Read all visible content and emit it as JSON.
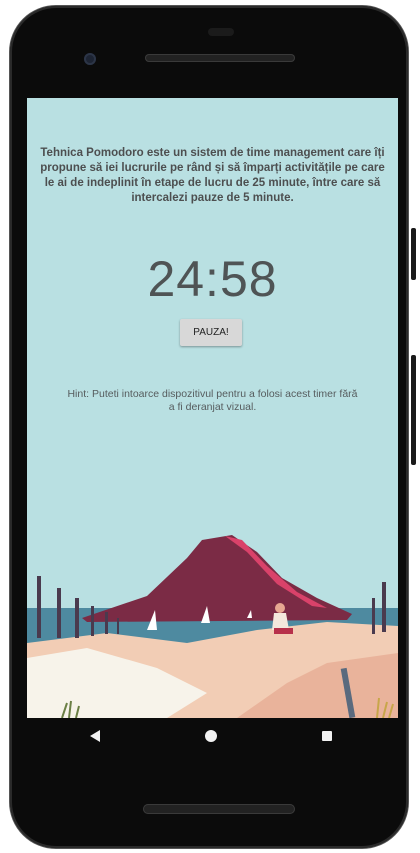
{
  "app": {
    "description": "Tehnica Pomodoro este un sistem de time management care îți propune să iei lucrurile pe rând și să împarți activitățile pe care le ai de indeplinit în etape de lucru de 25 minute, între care să intercalezi pauze de 5 minute.",
    "timer": "24:58",
    "pause_label": "PAUZA!",
    "hint": "Hint: Puteti intoarce dispozitivul pentru a folosi acest timer fără a fi deranjat vizual."
  },
  "navbar": {
    "back_icon": "back-triangle-icon",
    "home_icon": "home-circle-icon",
    "recents_icon": "recents-square-icon"
  },
  "colors": {
    "screen_background": "#b9e0e2",
    "mountain": "#7b2b45",
    "sand": "#f2cdb5",
    "sea": "#4e8aa0"
  }
}
